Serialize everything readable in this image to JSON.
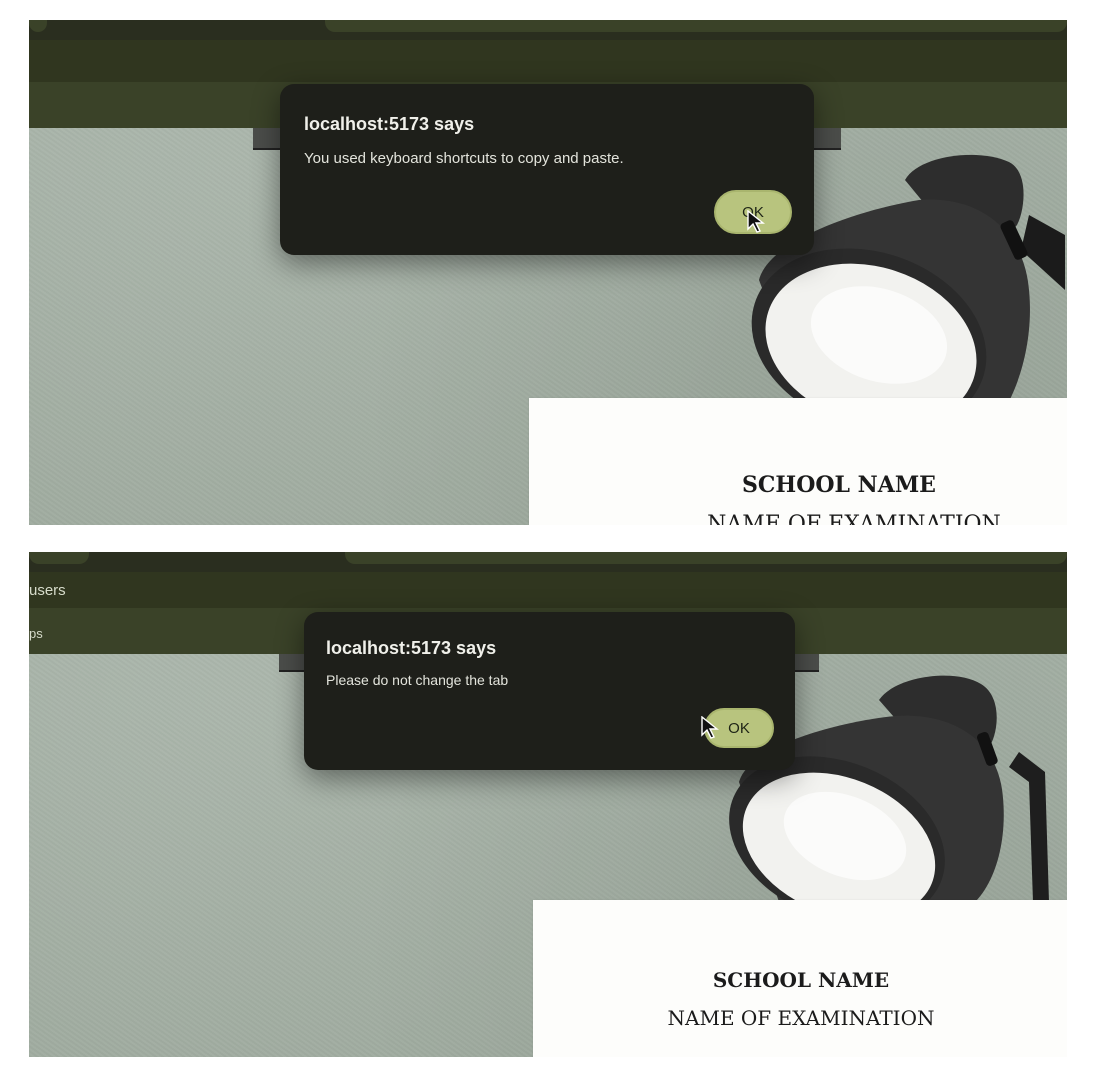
{
  "panels": [
    {
      "dialog": {
        "title": "localhost:5173 says",
        "message": "You used keyboard shortcuts to copy and paste.",
        "ok_label": "OK"
      },
      "nav": {
        "item_users": "",
        "item_apps": ""
      },
      "paper": {
        "school_name": "SCHOOL NAME",
        "exam_name": "NAME OF EXAMINATION"
      }
    },
    {
      "dialog": {
        "title": "localhost:5173 says",
        "message": "Please do not change the tab",
        "ok_label": "OK"
      },
      "nav": {
        "item_users": "users",
        "item_apps": "ps"
      },
      "paper": {
        "school_name": "SCHOOL NAME",
        "exam_name": "NAME OF EXAMINATION"
      }
    }
  ],
  "colors": {
    "wall": "#a4b0a5",
    "header_dark": "#2a2e1f",
    "header_olive": "#3a4228",
    "dialog_bg": "#1e1f1a",
    "ok_button": "#b8c47e"
  }
}
